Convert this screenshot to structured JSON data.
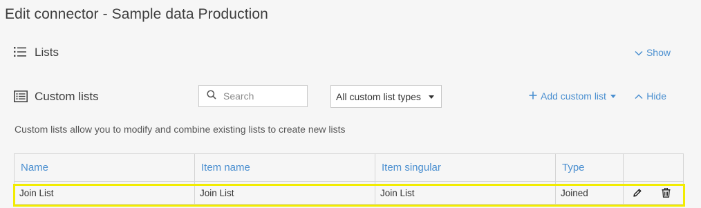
{
  "header": {
    "title": "Edit connector - Sample data Production"
  },
  "lists_section": {
    "label": "Lists",
    "show_label": "Show"
  },
  "custom_section": {
    "label": "Custom lists",
    "search_placeholder": "Search",
    "filter_selected": "All custom list types",
    "add_label": "Add custom list",
    "hide_label": "Hide",
    "description": "Custom lists allow you to modify and combine existing lists to create new lists"
  },
  "table": {
    "columns": [
      "Name",
      "Item name",
      "Item singular",
      "Type",
      ""
    ],
    "rows": [
      {
        "name": "Join List",
        "item_name": "Join List",
        "item_singular": "Join List",
        "type": "Joined"
      }
    ]
  },
  "icons": {
    "lists": "list-icon",
    "custom_lists": "custom-list-icon",
    "search": "search-icon",
    "show": "chevron-down-icon",
    "add": "plus-icon",
    "hide": "chevron-up-icon",
    "edit": "pencil-icon",
    "delete": "trash-icon"
  },
  "colors": {
    "accent": "#4a8fd0",
    "highlight": "#f2ec00"
  }
}
